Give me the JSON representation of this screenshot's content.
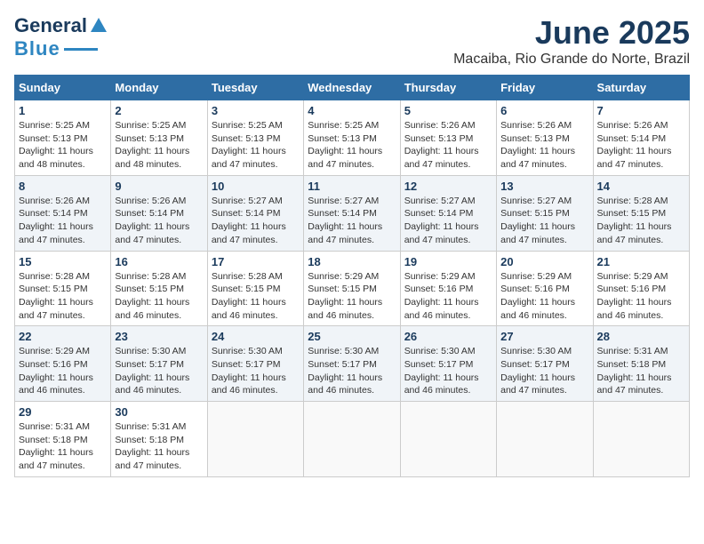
{
  "header": {
    "logo_line1": "General",
    "logo_line2": "Blue",
    "month": "June 2025",
    "location": "Macaiba, Rio Grande do Norte, Brazil"
  },
  "days_of_week": [
    "Sunday",
    "Monday",
    "Tuesday",
    "Wednesday",
    "Thursday",
    "Friday",
    "Saturday"
  ],
  "weeks": [
    [
      {
        "day": "1",
        "sunrise": "5:25 AM",
        "sunset": "5:13 PM",
        "daylight": "11 hours and 48 minutes."
      },
      {
        "day": "2",
        "sunrise": "5:25 AM",
        "sunset": "5:13 PM",
        "daylight": "11 hours and 48 minutes."
      },
      {
        "day": "3",
        "sunrise": "5:25 AM",
        "sunset": "5:13 PM",
        "daylight": "11 hours and 47 minutes."
      },
      {
        "day": "4",
        "sunrise": "5:25 AM",
        "sunset": "5:13 PM",
        "daylight": "11 hours and 47 minutes."
      },
      {
        "day": "5",
        "sunrise": "5:26 AM",
        "sunset": "5:13 PM",
        "daylight": "11 hours and 47 minutes."
      },
      {
        "day": "6",
        "sunrise": "5:26 AM",
        "sunset": "5:13 PM",
        "daylight": "11 hours and 47 minutes."
      },
      {
        "day": "7",
        "sunrise": "5:26 AM",
        "sunset": "5:14 PM",
        "daylight": "11 hours and 47 minutes."
      }
    ],
    [
      {
        "day": "8",
        "sunrise": "5:26 AM",
        "sunset": "5:14 PM",
        "daylight": "11 hours and 47 minutes."
      },
      {
        "day": "9",
        "sunrise": "5:26 AM",
        "sunset": "5:14 PM",
        "daylight": "11 hours and 47 minutes."
      },
      {
        "day": "10",
        "sunrise": "5:27 AM",
        "sunset": "5:14 PM",
        "daylight": "11 hours and 47 minutes."
      },
      {
        "day": "11",
        "sunrise": "5:27 AM",
        "sunset": "5:14 PM",
        "daylight": "11 hours and 47 minutes."
      },
      {
        "day": "12",
        "sunrise": "5:27 AM",
        "sunset": "5:14 PM",
        "daylight": "11 hours and 47 minutes."
      },
      {
        "day": "13",
        "sunrise": "5:27 AM",
        "sunset": "5:15 PM",
        "daylight": "11 hours and 47 minutes."
      },
      {
        "day": "14",
        "sunrise": "5:28 AM",
        "sunset": "5:15 PM",
        "daylight": "11 hours and 47 minutes."
      }
    ],
    [
      {
        "day": "15",
        "sunrise": "5:28 AM",
        "sunset": "5:15 PM",
        "daylight": "11 hours and 47 minutes."
      },
      {
        "day": "16",
        "sunrise": "5:28 AM",
        "sunset": "5:15 PM",
        "daylight": "11 hours and 46 minutes."
      },
      {
        "day": "17",
        "sunrise": "5:28 AM",
        "sunset": "5:15 PM",
        "daylight": "11 hours and 46 minutes."
      },
      {
        "day": "18",
        "sunrise": "5:29 AM",
        "sunset": "5:15 PM",
        "daylight": "11 hours and 46 minutes."
      },
      {
        "day": "19",
        "sunrise": "5:29 AM",
        "sunset": "5:16 PM",
        "daylight": "11 hours and 46 minutes."
      },
      {
        "day": "20",
        "sunrise": "5:29 AM",
        "sunset": "5:16 PM",
        "daylight": "11 hours and 46 minutes."
      },
      {
        "day": "21",
        "sunrise": "5:29 AM",
        "sunset": "5:16 PM",
        "daylight": "11 hours and 46 minutes."
      }
    ],
    [
      {
        "day": "22",
        "sunrise": "5:29 AM",
        "sunset": "5:16 PM",
        "daylight": "11 hours and 46 minutes."
      },
      {
        "day": "23",
        "sunrise": "5:30 AM",
        "sunset": "5:17 PM",
        "daylight": "11 hours and 46 minutes."
      },
      {
        "day": "24",
        "sunrise": "5:30 AM",
        "sunset": "5:17 PM",
        "daylight": "11 hours and 46 minutes."
      },
      {
        "day": "25",
        "sunrise": "5:30 AM",
        "sunset": "5:17 PM",
        "daylight": "11 hours and 46 minutes."
      },
      {
        "day": "26",
        "sunrise": "5:30 AM",
        "sunset": "5:17 PM",
        "daylight": "11 hours and 46 minutes."
      },
      {
        "day": "27",
        "sunrise": "5:30 AM",
        "sunset": "5:17 PM",
        "daylight": "11 hours and 47 minutes."
      },
      {
        "day": "28",
        "sunrise": "5:31 AM",
        "sunset": "5:18 PM",
        "daylight": "11 hours and 47 minutes."
      }
    ],
    [
      {
        "day": "29",
        "sunrise": "5:31 AM",
        "sunset": "5:18 PM",
        "daylight": "11 hours and 47 minutes."
      },
      {
        "day": "30",
        "sunrise": "5:31 AM",
        "sunset": "5:18 PM",
        "daylight": "11 hours and 47 minutes."
      },
      null,
      null,
      null,
      null,
      null
    ]
  ],
  "labels": {
    "sunrise": "Sunrise:",
    "sunset": "Sunset:",
    "daylight": "Daylight:"
  }
}
